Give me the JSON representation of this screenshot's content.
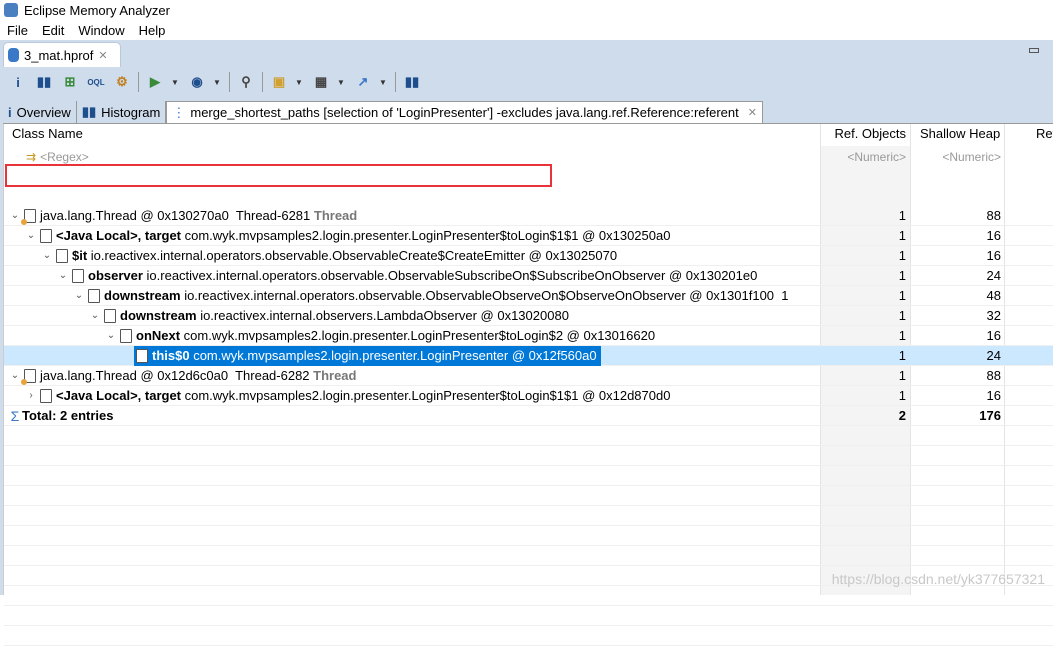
{
  "window": {
    "title": "Eclipse Memory Analyzer"
  },
  "menu": [
    "File",
    "Edit",
    "Window",
    "Help"
  ],
  "editor_tab": {
    "label": "3_mat.hprof"
  },
  "view_tabs": [
    {
      "label": "Overview",
      "icon": "info-icon"
    },
    {
      "label": "Histogram",
      "icon": "histogram-icon"
    },
    {
      "label": "merge_shortest_paths [selection of 'LoginPresenter'] -excludes java.lang.ref.Reference:referent",
      "icon": "tree-icon"
    }
  ],
  "columns": {
    "name": "Class Name",
    "ref_objects": "Ref. Objects",
    "shallow_heap": "Shallow Heap",
    "ref_heap": "Ref"
  },
  "filters": {
    "regex": "<Regex>",
    "numeric1": "<Numeric>",
    "numeric2": "<Numeric>"
  },
  "rows": [
    {
      "level": 0,
      "toggle": "expanded",
      "icon": "thread",
      "bold": "",
      "text": "java.lang.Thread @ 0x130270a0  Thread-6281 ",
      "gray": "Thread",
      "ref": "1",
      "shallow": "88"
    },
    {
      "level": 1,
      "toggle": "expanded",
      "icon": "file",
      "bold": "<Java Local>, target",
      "text": " com.wyk.mvpsamples2.login.presenter.LoginPresenter$toLogin$1$1 @ 0x130250a0",
      "gray": "",
      "ref": "1",
      "shallow": "16"
    },
    {
      "level": 2,
      "toggle": "expanded",
      "icon": "file",
      "bold": "$it",
      "text": " io.reactivex.internal.operators.observable.ObservableCreate$CreateEmitter @ 0x13025070",
      "gray": "",
      "ref": "1",
      "shallow": "16"
    },
    {
      "level": 3,
      "toggle": "expanded",
      "icon": "file",
      "bold": "observer",
      "text": " io.reactivex.internal.operators.observable.ObservableSubscribeOn$SubscribeOnObserver @ 0x130201e0",
      "gray": "",
      "ref": "1",
      "shallow": "24"
    },
    {
      "level": 4,
      "toggle": "expanded",
      "icon": "file",
      "bold": "downstream",
      "text": " io.reactivex.internal.operators.observable.ObservableObserveOn$ObserveOnObserver @ 0x1301f100  1",
      "gray": "",
      "ref": "1",
      "shallow": "48"
    },
    {
      "level": 5,
      "toggle": "expanded",
      "icon": "file",
      "bold": "downstream",
      "text": " io.reactivex.internal.observers.LambdaObserver @ 0x13020080",
      "gray": "",
      "ref": "1",
      "shallow": "32"
    },
    {
      "level": 6,
      "toggle": "expanded",
      "icon": "file",
      "bold": "onNext",
      "text": " com.wyk.mvpsamples2.login.presenter.LoginPresenter$toLogin$2 @ 0x13016620",
      "gray": "",
      "ref": "1",
      "shallow": "16"
    },
    {
      "level": 7,
      "toggle": "none",
      "icon": "file",
      "bold": "this$0",
      "text": " com.wyk.mvpsamples2.login.presenter.LoginPresenter @ 0x12f560a0",
      "gray": "",
      "ref": "1",
      "shallow": "24",
      "selected": true
    },
    {
      "level": 0,
      "toggle": "expanded",
      "icon": "thread",
      "bold": "",
      "text": "java.lang.Thread @ 0x12d6c0a0  Thread-6282 ",
      "gray": "Thread",
      "ref": "1",
      "shallow": "88"
    },
    {
      "level": 1,
      "toggle": "collapsed",
      "icon": "file",
      "bold": "<Java Local>, target",
      "text": " com.wyk.mvpsamples2.login.presenter.LoginPresenter$toLogin$1$1 @ 0x12d870d0",
      "gray": "",
      "ref": "1",
      "shallow": "16"
    },
    {
      "level": 0,
      "toggle": "sigma",
      "icon": "none",
      "bold": "Total: 2 entries",
      "text": "",
      "gray": "",
      "ref": "2",
      "shallow": "176",
      "total": true
    }
  ],
  "watermark": "https://blog.csdn.net/yk377657321",
  "colors": {
    "selection": "#0078d7",
    "selection_row": "#cce8ff",
    "highlight_box": "#e8333a",
    "chrome": "#cfdcec"
  }
}
